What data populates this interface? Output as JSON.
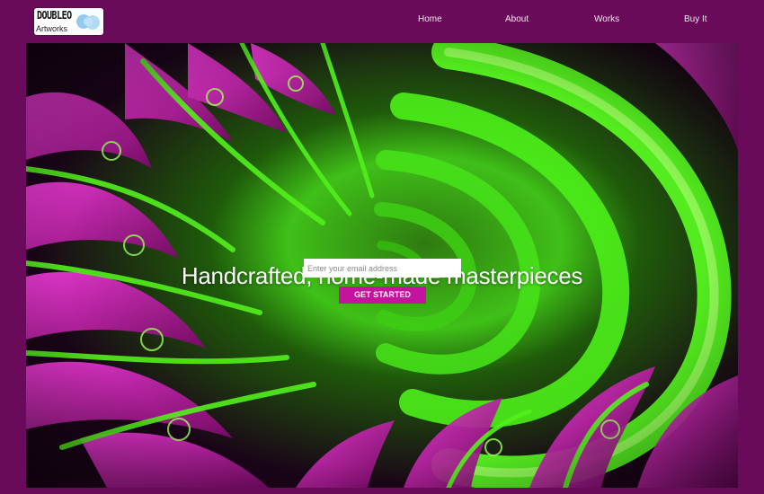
{
  "brand": {
    "logo_line1": "DOUBLEO",
    "logo_line2": "Artworks",
    "logo_icon": "double-circle-logo-icon",
    "logo_circle_color": "#8ec8ec"
  },
  "nav": {
    "items": [
      {
        "label": "Home"
      },
      {
        "label": "About"
      },
      {
        "label": "Works"
      },
      {
        "label": "Buy It"
      }
    ]
  },
  "hero": {
    "title": "Handcrafted, home-made masterpieces",
    "email_placeholder": "Enter your email address",
    "email_value": "",
    "cta_label": "GET STARTED",
    "background": "green-magenta-spiral-fractal-image"
  },
  "colors": {
    "page_background": "#6a0a5a",
    "nav_text": "#f1e6ee",
    "cta_button": "#c4139e",
    "fractal_green": "#4dff1a",
    "fractal_magenta": "#e020c8"
  }
}
